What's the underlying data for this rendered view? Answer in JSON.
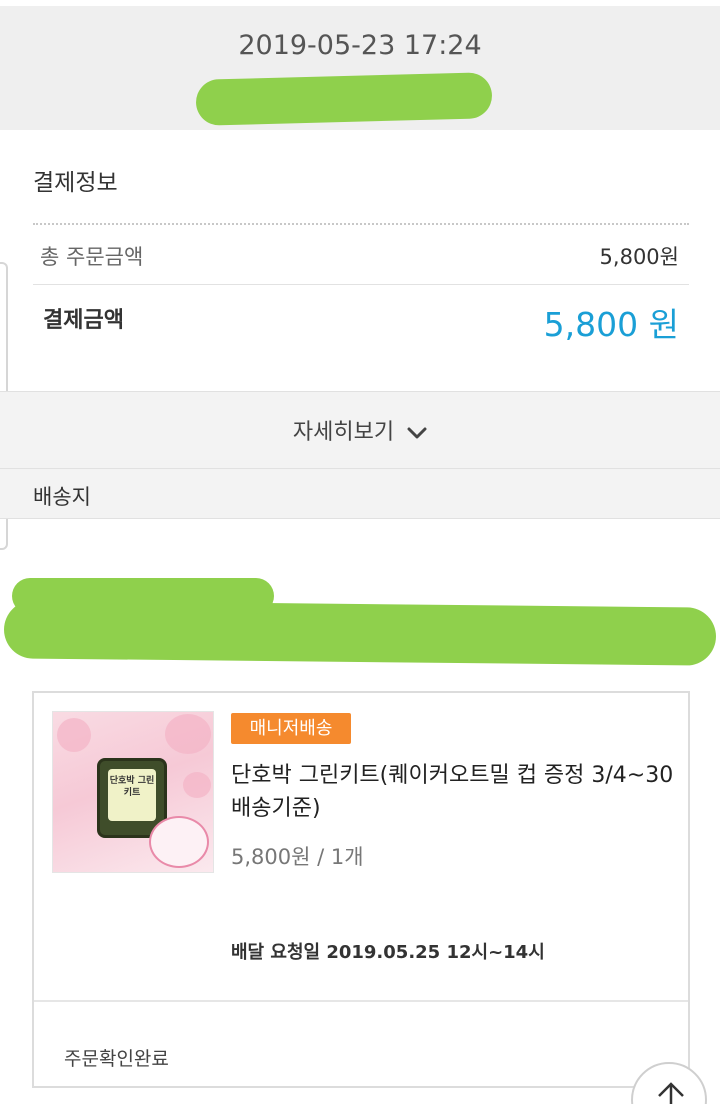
{
  "header": {
    "order_datetime": "2019-05-23 17:24"
  },
  "payment_info": {
    "title": "결제정보",
    "total_order_label": "총 주문금액",
    "total_order_value": "5,800원",
    "payment_amount_label": "결제금액",
    "payment_amount_value": "5,800 원",
    "accent_color": "#1a9fd6"
  },
  "details_toggle": {
    "label": "자세히보기",
    "icon": "chevron-down-icon"
  },
  "shipping": {
    "title": "배송지"
  },
  "order_item": {
    "badge": "매니저배송",
    "badge_color": "#f58a2e",
    "product_name": "단호박 그린키트(퀘이커오트밀 컵 증정 3/4~30 배송기준)",
    "price_quantity": "5,800원 / 1개",
    "delivery_request": "배달 요청일 2019.05.25 12시~14시",
    "status": "주문확인완료",
    "thumbnail": {
      "label_text": "단호박 그린키트"
    }
  },
  "scroll_top": {
    "icon": "arrow-up-icon"
  }
}
